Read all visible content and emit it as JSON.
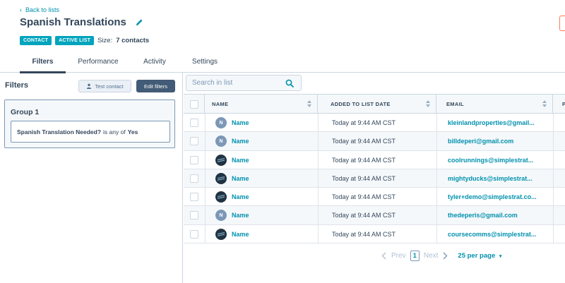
{
  "header": {
    "back_label": "Back to lists",
    "title": "Spanish Translations",
    "tags": [
      "CONTACT",
      "ACTIVE LIST"
    ],
    "size_label": "Size:",
    "size_value": "7 contacts"
  },
  "tabs": [
    {
      "label": "Filters",
      "active": true
    },
    {
      "label": "Performance",
      "active": false
    },
    {
      "label": "Activity",
      "active": false
    },
    {
      "label": "Settings",
      "active": false
    }
  ],
  "filters_panel": {
    "heading": "Filters",
    "test_contact_label": "Test contact",
    "edit_filters_label": "Edit filters",
    "group_title": "Group 1",
    "filter": {
      "property": "Spanish Translation Needed?",
      "operator": "is any of",
      "value": "Yes"
    }
  },
  "search": {
    "placeholder": "Search in list"
  },
  "table": {
    "columns": [
      "NAME",
      "ADDED TO LIST DATE",
      "EMAIL",
      "P"
    ],
    "rows": [
      {
        "avatar": "N",
        "avatar_type": "letter",
        "name": "Name",
        "added": "Today at 9:44 AM CST",
        "email": "kleinlandproperties@gmail..."
      },
      {
        "avatar": "N",
        "avatar_type": "letter",
        "name": "Name",
        "added": "Today at 9:44 AM CST",
        "email": "billdeperi@gmail.com"
      },
      {
        "avatar": "",
        "avatar_type": "logo",
        "name": "Name",
        "added": "Today at 9:44 AM CST",
        "email": "coolrunnings@simplestrat..."
      },
      {
        "avatar": "",
        "avatar_type": "logo",
        "name": "Name",
        "added": "Today at 9:44 AM CST",
        "email": "mightyducks@simplestrat..."
      },
      {
        "avatar": "",
        "avatar_type": "logo",
        "name": "Name",
        "added": "Today at 9:44 AM CST",
        "email": "tyler+demo@simplestrat.co..."
      },
      {
        "avatar": "N",
        "avatar_type": "letter",
        "name": "Name",
        "added": "Today at 9:44 AM CST",
        "email": "thedeperis@gmail.com"
      },
      {
        "avatar": "",
        "avatar_type": "logo",
        "name": "Name",
        "added": "Today at 9:44 AM CST",
        "email": "coursecomms@simplestrat..."
      }
    ]
  },
  "pagination": {
    "prev_label": "Prev",
    "current_page": "1",
    "next_label": "Next",
    "per_page_label": "25 per page"
  },
  "colors": {
    "accent": "#0091ae",
    "tag": "#00a4bd",
    "dark_button": "#425b76",
    "text": "#33475b"
  }
}
